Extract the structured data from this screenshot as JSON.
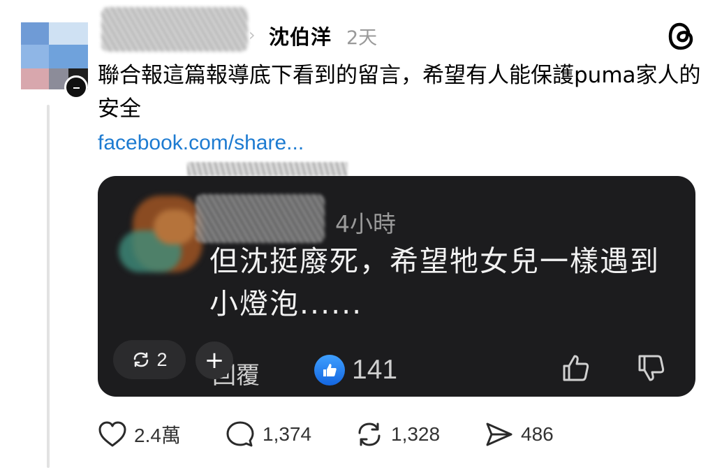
{
  "post": {
    "author": "沈伯洋",
    "time_ago": "2天",
    "text": "聯合報這篇報導底下看到的留言，希望有人能保護puma家人的安全",
    "link": "facebook.com/share...",
    "icons": {
      "app": "threads-logo-icon",
      "chevron": "chevron-right-icon"
    }
  },
  "embed": {
    "time": "4小時",
    "text": "但沈挺廢死，希望牠女兒一樣遇到小燈泡......",
    "reply_label": "回覆",
    "like_count": "141",
    "colors": {
      "background": "#1c1c1e",
      "like_badge": "#1877f2"
    }
  },
  "overlay": {
    "repost_count": "2",
    "plus_label": "+"
  },
  "actions": {
    "likes": "2.4萬",
    "comments": "1,374",
    "reposts": "1,328",
    "shares": "486"
  }
}
